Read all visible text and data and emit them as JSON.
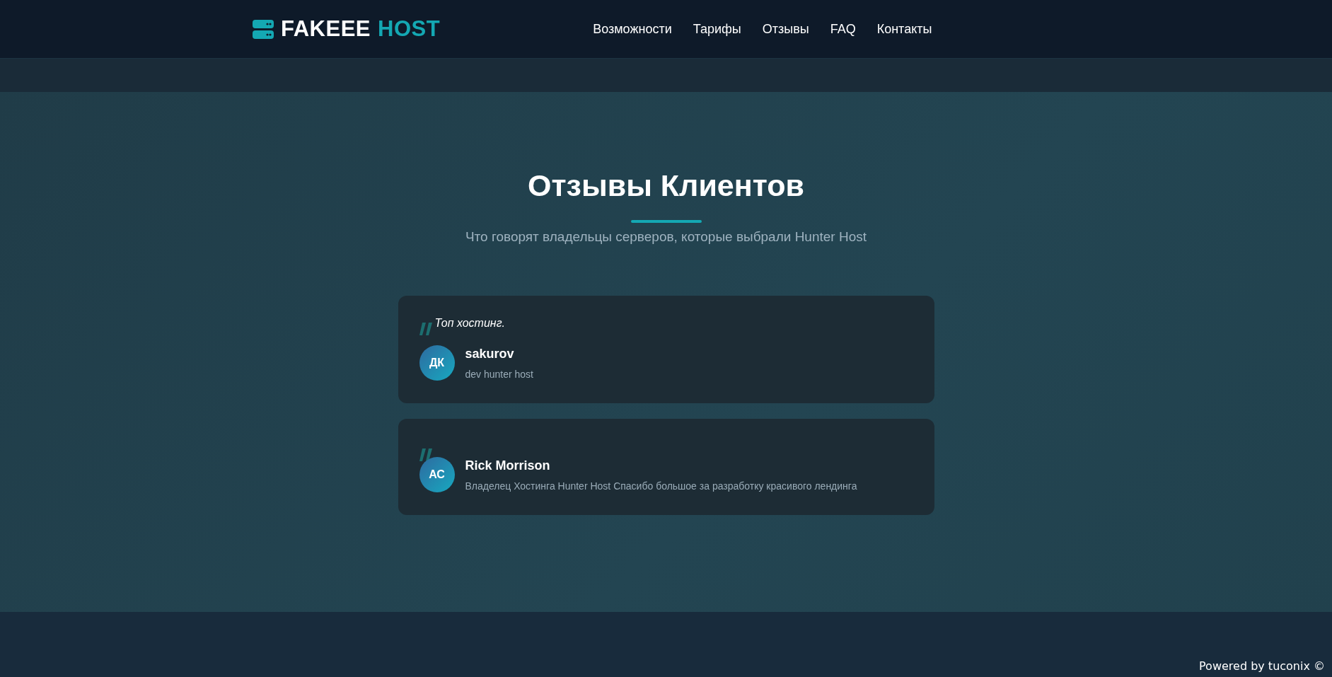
{
  "header": {
    "logo": {
      "word_1": "FAKEEE",
      "word_2": "HOST"
    },
    "nav": [
      {
        "label": "Возможности"
      },
      {
        "label": "Тарифы"
      },
      {
        "label": "Отзывы"
      },
      {
        "label": "FAQ"
      },
      {
        "label": "Контакты"
      }
    ]
  },
  "section": {
    "title": "Отзывы Клиентов",
    "subtitle": "Что говорят владельцы серверов, которые выбрали Hunter Host"
  },
  "testimonials": [
    {
      "quote": "Топ хостинг.",
      "initials": "ДК",
      "name": "sakurov",
      "role": "dev hunter host"
    },
    {
      "initials": "АС",
      "name": "Rick Morrison",
      "role": "Владелец Хостинга Hunter Host Спасибо большое за разработку красивого лендинга"
    }
  ],
  "footer": {
    "text": "Powered by tuconix ©"
  }
}
